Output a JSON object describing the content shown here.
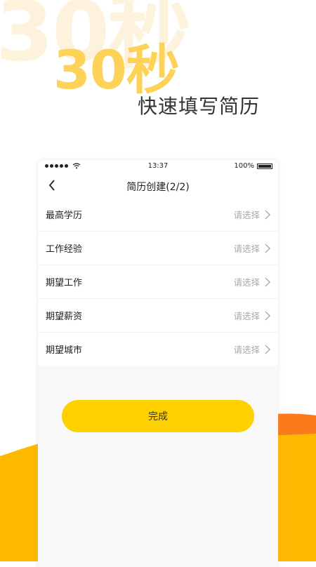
{
  "hero": {
    "bg_text": "30秒",
    "title": "30秒",
    "subtitle": "快速填写简历"
  },
  "status_bar": {
    "time": "13:37",
    "battery": "100%"
  },
  "nav": {
    "title": "简历创建(2/2)"
  },
  "form": {
    "rows": [
      {
        "label": "最高学历",
        "value": "请选择"
      },
      {
        "label": "工作经验",
        "value": "请选择"
      },
      {
        "label": "期望工作",
        "value": "请选择"
      },
      {
        "label": "期望薪资",
        "value": "请选择"
      },
      {
        "label": "期望城市",
        "value": "请选择"
      }
    ]
  },
  "actions": {
    "done_label": "完成"
  },
  "colors": {
    "accent": "#fdd100",
    "hero_yellow": "#fdd256",
    "wave_orange": "#fb7a1c",
    "wave_yellow": "#fdb800"
  }
}
